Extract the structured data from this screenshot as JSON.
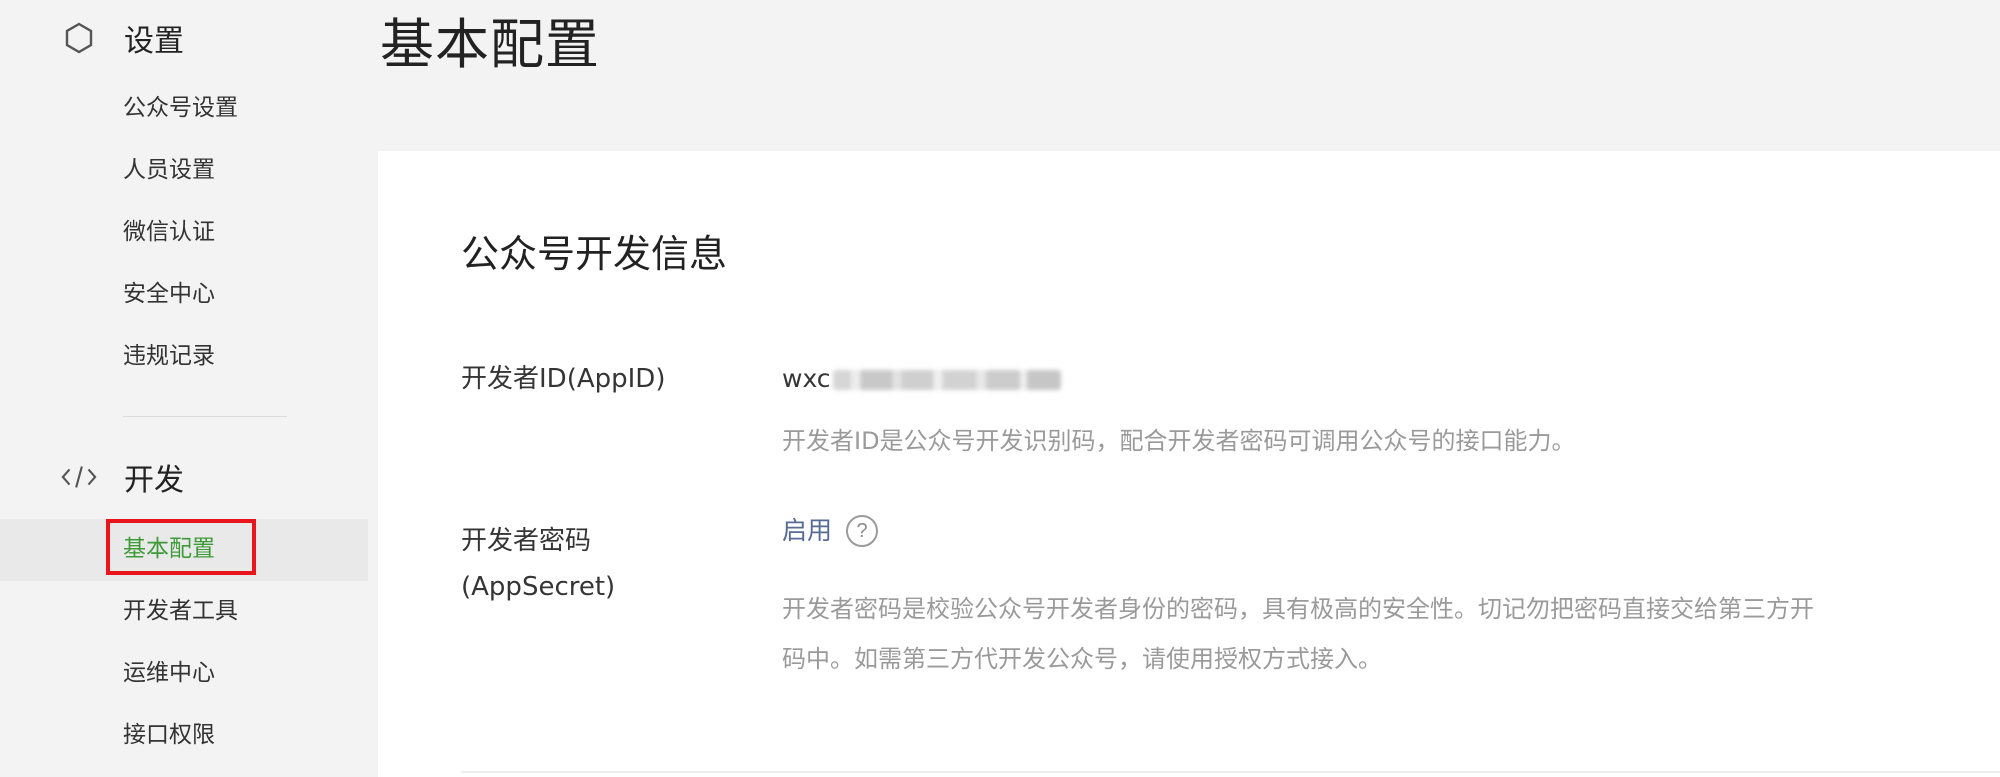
{
  "sidebar": {
    "groups": [
      {
        "icon": "gear-icon",
        "label": "设置",
        "items": [
          "公众号设置",
          "人员设置",
          "微信认证",
          "安全中心",
          "违规记录"
        ]
      },
      {
        "icon": "code-icon",
        "label": "开发",
        "items": [
          "基本配置",
          "开发者工具",
          "运维中心",
          "接口权限"
        ],
        "active_item": "基本配置"
      }
    ]
  },
  "page": {
    "title": "基本配置"
  },
  "section": {
    "title": "公众号开发信息",
    "fields": [
      {
        "label": "开发者ID(AppID)",
        "value_prefix": "wxc",
        "value_masked": true,
        "description": "开发者ID是公众号开发识别码，配合开发者密码可调用公众号的接口能力。"
      },
      {
        "label_line1": "开发者密码",
        "label_line2": "(AppSecret)",
        "action": "启用",
        "help_icon": "question-circle-icon",
        "description_line1": "开发者密码是校验公众号开发者身份的密码，具有极高的安全性。切记勿把密码直接交给第三方开",
        "description_line2": "码中。如需第三方代开发公众号，请使用授权方式接入。"
      }
    ]
  },
  "colors": {
    "active_nav": "#3f9b38",
    "highlight_box": "#e8151c",
    "link": "#576b95"
  }
}
